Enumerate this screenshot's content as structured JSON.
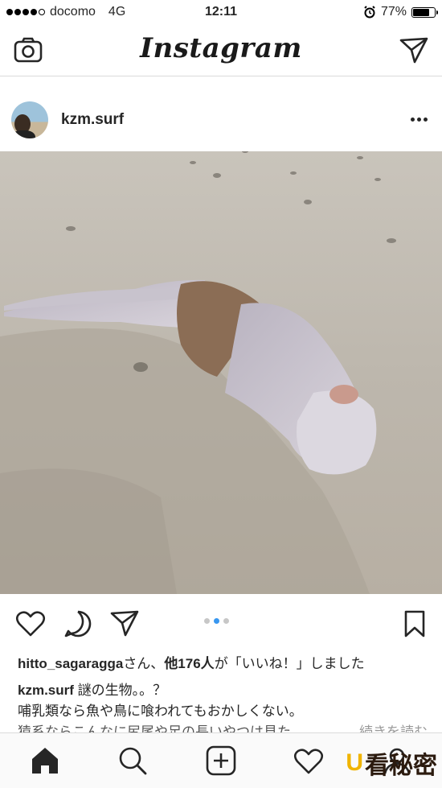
{
  "status_bar": {
    "carrier": "docomo",
    "network": "4G",
    "time": "12:11",
    "battery": "77%",
    "battery_level": 0.77
  },
  "top_nav": {
    "logo": "Instagram",
    "camera_icon": "camera-icon",
    "direct_icon": "paper-plane-icon"
  },
  "post": {
    "username": "kzm.surf",
    "likes_user": "hitto_sagaragga",
    "likes_text_1": "さん、",
    "likes_count": "他176人",
    "likes_text_2": "が「いいね！」しました",
    "caption_user": "kzm.surf",
    "caption_line1": " 謎の生物。。？",
    "caption_line2": "哺乳類なら魚や鳥に喰われてもおかしくない。",
    "caption_line3": "猿系ならこんなに尻尾や足の長いやつは見た",
    "more_label": "... 続きを読む"
  },
  "tab_bar": {
    "items": [
      "home-icon",
      "search-icon",
      "add-post-icon",
      "activity-icon",
      "profile-icon"
    ]
  },
  "watermark": {
    "mark": "U",
    "text": "看秘密"
  },
  "colors": {
    "accent": "#3897f0",
    "border": "#dbdbdb",
    "sand": "#bdb7ad"
  }
}
